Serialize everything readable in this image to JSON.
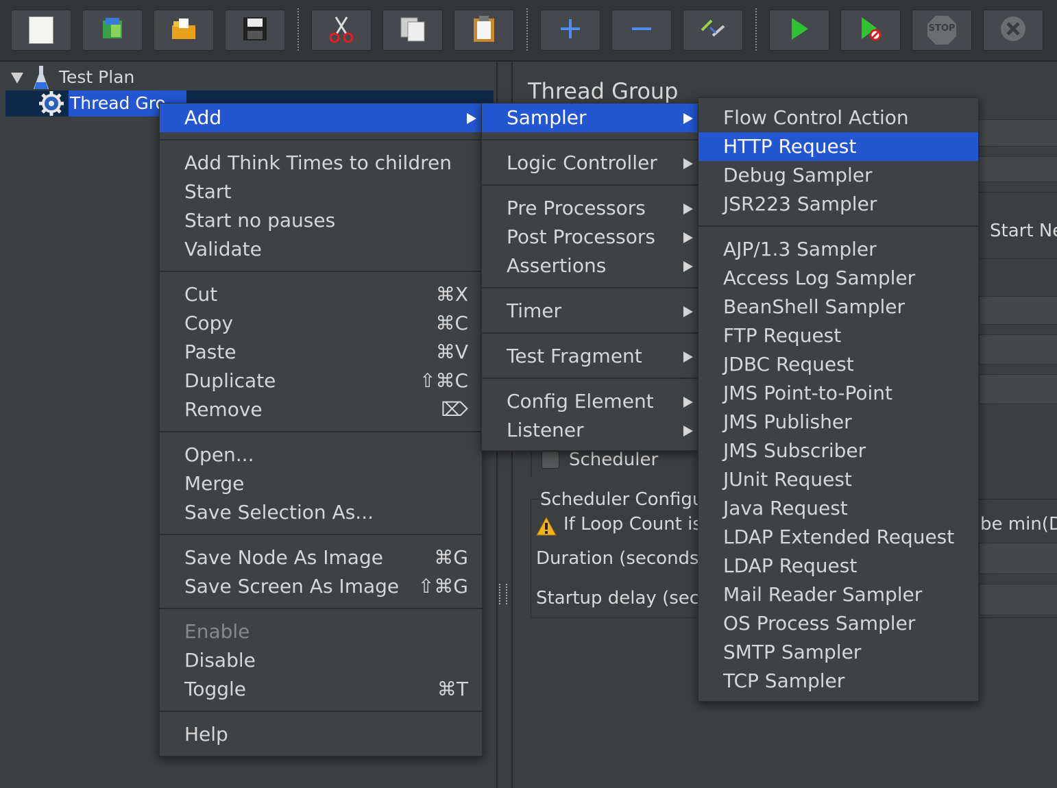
{
  "toolbar": {
    "buttons": [
      "new-icon",
      "templates-icon",
      "open-icon",
      "save-icon",
      "cut-icon",
      "copy-icon",
      "paste-icon",
      "expand-icon",
      "collapse-icon",
      "toggle-icon",
      "start-icon",
      "start-no-pauses-icon",
      "stop-icon",
      "shutdown-icon"
    ],
    "stop_text": "STOP"
  },
  "tree": {
    "root": "Test Plan",
    "child": "Thread Gro"
  },
  "right_panel": {
    "title": "Thread Group",
    "start_next": "Start Ne",
    "scheduler": "Scheduler",
    "scheduler_config": "Scheduler Configu",
    "loop_warning": "If Loop Count is",
    "warning_tail": "be min(D",
    "duration": "Duration (seconds)",
    "startup_delay": "Startup delay (seco"
  },
  "menu_main": {
    "items": [
      {
        "label": "Add",
        "submenu": true
      },
      {
        "label": "Add Think Times to children"
      },
      {
        "label": "Start"
      },
      {
        "label": "Start no pauses"
      },
      {
        "label": "Validate"
      },
      {
        "label": "Cut",
        "shortcut": "⌘X"
      },
      {
        "label": "Copy",
        "shortcut": "⌘C"
      },
      {
        "label": "Paste",
        "shortcut": "⌘V"
      },
      {
        "label": "Duplicate",
        "shortcut": "⇧⌘C"
      },
      {
        "label": "Remove",
        "shortcut": "⌦"
      },
      {
        "label": "Open..."
      },
      {
        "label": "Merge"
      },
      {
        "label": "Save Selection As..."
      },
      {
        "label": "Save Node As Image",
        "shortcut": "⌘G"
      },
      {
        "label": "Save Screen As Image",
        "shortcut": "⇧⌘G"
      },
      {
        "label": "Enable",
        "disabled": true
      },
      {
        "label": "Disable"
      },
      {
        "label": "Toggle",
        "shortcut": "⌘T"
      },
      {
        "label": "Help"
      }
    ]
  },
  "menu_add": {
    "items": [
      "Sampler",
      "Logic Controller",
      "Pre Processors",
      "Post Processors",
      "Assertions",
      "Timer",
      "Test Fragment",
      "Config Element",
      "Listener"
    ]
  },
  "menu_sampler": {
    "items": [
      "Flow Control Action",
      "HTTP Request",
      "Debug Sampler",
      "JSR223 Sampler",
      "AJP/1.3 Sampler",
      "Access Log Sampler",
      "BeanShell Sampler",
      "FTP Request",
      "JDBC Request",
      "JMS Point-to-Point",
      "JMS Publisher",
      "JMS Subscriber",
      "JUnit Request",
      "Java Request",
      "LDAP Extended Request",
      "LDAP Request",
      "Mail Reader Sampler",
      "OS Process Sampler",
      "SMTP Sampler",
      "TCP Sampler"
    ],
    "highlighted": "HTTP Request"
  },
  "colors": {
    "highlight": "#2356d0",
    "background": "#3c3f41",
    "menu": "#3f4245"
  }
}
